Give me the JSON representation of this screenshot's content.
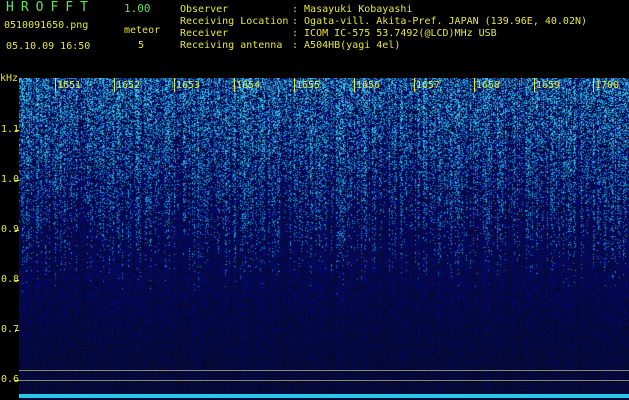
{
  "app": {
    "title": "HROFFT",
    "version": "1.00"
  },
  "file": {
    "name": "0510091650.png",
    "datetime": "05.10.09 16:50"
  },
  "meteor": {
    "label": "meteor",
    "count": "5"
  },
  "info": [
    {
      "label": "Observer",
      "value": ": Masayuki Kobayashi"
    },
    {
      "label": "Receiving Location",
      "value": ": Ogata-vill. Akita-Pref. JAPAN (139.96E, 40.02N)"
    },
    {
      "label": "Receiver",
      "value": ": ICOM IC-575 53.7492(@LCD)MHz USB"
    },
    {
      "label": "Receiving antenna",
      "value": ": A504HB(yagi 4el)"
    }
  ],
  "axis": {
    "unit": "kHz",
    "y_labels": [
      "1.1",
      "1.0",
      "0.9",
      "0.8",
      "0.7",
      "0.6"
    ],
    "time_labels": [
      "1651",
      "1652",
      "1653",
      "1654",
      "1655",
      "1656",
      "1657",
      "1658",
      "1659",
      "1700"
    ]
  },
  "colors": {
    "text": "#e6e640",
    "title": "#5fe05f",
    "baseline": "#28c8e8",
    "background": "#000000"
  }
}
